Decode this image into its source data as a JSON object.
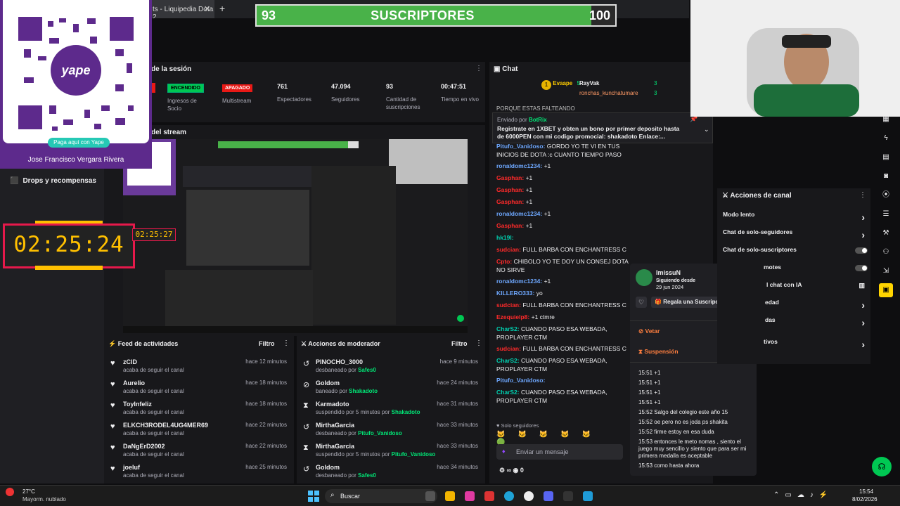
{
  "browser_tab": {
    "title": "ts - Liquipedia Dota 2",
    "close": "✕",
    "new": "+"
  },
  "subgoal": {
    "current": "93",
    "label": "SUSCRIPTORES",
    "target": "100",
    "progress": 0.93
  },
  "qr": {
    "button": "Paga aquí con Yape",
    "name": "Jose Francisco Vergara Rivera",
    "logo": "yape"
  },
  "left_nav": {
    "item": "Drops y recompensas"
  },
  "timer": {
    "value": "02:25:24",
    "mini": "02:25:27"
  },
  "session": {
    "title": "de la sesión",
    "stats": [
      {
        "badge": "ENCENDIDO",
        "label": "Ingresos de Socio"
      },
      {
        "badge": "APAGADO",
        "label": "Multistream"
      },
      {
        "value": "761",
        "label": "Espectadores"
      },
      {
        "value": "47.094",
        "label": "Seguidores"
      },
      {
        "value": "93",
        "label": "Cantidad de suscripciones"
      },
      {
        "value": "00:47:51",
        "label": "Tiempo en vivo"
      }
    ]
  },
  "stream_preview": {
    "title": "del stream"
  },
  "feed": {
    "title": "Feed de actividades",
    "filter": "Filtro",
    "items": [
      {
        "name": "zCID",
        "action": "acaba de seguir el canal",
        "time": "hace 12 minutos"
      },
      {
        "name": "Aurelio",
        "action": "acaba de seguir el canal",
        "time": "hace 18 minutos"
      },
      {
        "name": "ToyInfeliz",
        "action": "acaba de seguir el canal",
        "time": "hace 18 minutos"
      },
      {
        "name": "ELKCH3RODEL4UG4MER69",
        "action": "acaba de seguir el canal",
        "time": "hace 22 minutos"
      },
      {
        "name": "DaNgErD2002",
        "action": "acaba de seguir el canal",
        "time": "hace 22 minutos"
      },
      {
        "name": "joeluf",
        "action": "acaba de seguir el canal",
        "time": "hace 25 minutos"
      }
    ]
  },
  "modactions": {
    "title": "Acciones de moderador",
    "filter": "Filtro",
    "items": [
      {
        "name": "PINOCHO_3000",
        "action": "desbaneado por",
        "by": "Safes0",
        "time": "hace 9 minutos",
        "icon": "undo"
      },
      {
        "name": "Goldom",
        "action": "baneado por",
        "by": "Shakadoto",
        "time": "hace 24 minutos",
        "icon": "ban"
      },
      {
        "name": "Karmadoto",
        "action": "suspendido por 5 minutos por",
        "by": "Shakadoto",
        "time": "hace 31 minutos",
        "icon": "hourglass"
      },
      {
        "name": "MirthaGarcia",
        "action": "desbaneado por",
        "by": "Pitufo_Vanidoso",
        "time": "hace 33 minutos",
        "icon": "undo"
      },
      {
        "name": "MirthaGarcia",
        "action": "suspendido por 5 minutos por",
        "by": "Pitufo_Vanidoso",
        "time": "hace 33 minutos",
        "icon": "hourglass"
      },
      {
        "name": "Goldom",
        "action": "desbaneado por",
        "by": "Safes0",
        "time": "hace 34 minutos",
        "icon": "undo"
      }
    ]
  },
  "chat": {
    "title": "Chat",
    "top_users": [
      "Evaape",
      "RayVak",
      "ronchas_kunchatumare"
    ],
    "top_counts": [
      "5",
      "3",
      "3"
    ],
    "pinned_from": "Enviado por",
    "pinned_user": "BotRix",
    "pinned_text": "Registrate en 1XBET y obten un bono por primer deposito hasta de 6000PEN con mi codigo promocial: shakadoto Enlace:...",
    "top_cut": "PORQUE ESTAS FALTEANDO",
    "lines": [
      {
        "user": "Pitufo_Vanidoso:",
        "text": "GORDO YO TE VI EN TUS INICIOS DE DOTA :c CUANTO TIEMPO PASO",
        "color": "blue"
      },
      {
        "user": "ronaldomc1234:",
        "text": "+1",
        "color": "blue"
      },
      {
        "user": "Gasphan:",
        "text": "+1",
        "color": "red"
      },
      {
        "user": "Gasphan:",
        "text": "+1",
        "color": "red"
      },
      {
        "user": "Gasphan:",
        "text": "+1",
        "color": "red"
      },
      {
        "user": "ronaldomc1234:",
        "text": "+1",
        "color": "blue"
      },
      {
        "user": "Gasphan:",
        "text": "+1",
        "color": "red"
      },
      {
        "user": "hk19l:",
        "text": "",
        "color": "teal"
      },
      {
        "user": "sudcian:",
        "text": "FULL BARBA  CON ENCHANTRESS C",
        "color": "red"
      },
      {
        "user": "Cpto:",
        "text": "CHIBOLO YO TE DOY UN CONSEJ DOTA NO SIRVE",
        "color": "red"
      },
      {
        "user": "ronaldomc1234:",
        "text": "+1",
        "color": "blue"
      },
      {
        "user": "KILLERO333:",
        "text": "yo",
        "color": "blue"
      },
      {
        "user": "sudcian:",
        "text": "FULL BARBA  CON ENCHANTRESS C",
        "color": "red"
      },
      {
        "user": "Ezequielp8:",
        "text": "+1 ctmre",
        "color": "red"
      },
      {
        "user": "CharS2:",
        "text": "CUANDO PASO ESA WEBADA, PROPLAYER CTM",
        "color": "teal"
      },
      {
        "user": "sudcian:",
        "text": "FULL BARBA  CON ENCHANTRESS C",
        "color": "red"
      },
      {
        "user": "CharS2:",
        "text": "CUANDO PASO ESA WEBADA, PROPLAYER CTM",
        "color": "teal"
      },
      {
        "user": "Pitufo_Vanidoso:",
        "text": "",
        "color": "blue"
      },
      {
        "user": "CharS2:",
        "text": "CUANDO PASO ESA WEBADA, PROPLAYER CTM",
        "color": "teal"
      }
    ],
    "followers_only": "Solo seguidores",
    "input_placeholder": "Enviar un mensaje",
    "bits": "0"
  },
  "usercard": {
    "name": "ImissuN",
    "since_label": "Siguiendo desde",
    "since_date": "29 jun 2024",
    "gift": "Regala una Suscripción",
    "ban": "Vetar",
    "timeout": "Suspensión",
    "messages": [
      {
        "t": "15:51",
        "m": "+1"
      },
      {
        "t": "15:51",
        "m": "+1"
      },
      {
        "t": "15:51",
        "m": "+1"
      },
      {
        "t": "15:51",
        "m": "+1"
      },
      {
        "t": "15:52",
        "m": "Salgo del colegio este año 15"
      },
      {
        "t": "15:52",
        "m": "oe pero no es joda ps shakita"
      },
      {
        "t": "15:52",
        "m": "firme estoy en esa duda"
      },
      {
        "t": "15:53",
        "m": "entonces le meto nomas , siento el juego muy sencillo y siento que para ser mi primera medalla es aceptable"
      },
      {
        "t": "15:53",
        "m": "como hasta ahora"
      }
    ]
  },
  "channel_actions": {
    "title": "Acciones de canal",
    "items": [
      {
        "label": "Modo lento",
        "type": "arrow"
      },
      {
        "label": "Chat de solo-seguidores",
        "type": "arrow"
      },
      {
        "label": "Chat de solo-suscriptores",
        "type": "toggle"
      },
      {
        "label": "motes",
        "type": "toggle"
      },
      {
        "label": "l chat con IA",
        "type": "bars"
      },
      {
        "label": "edad",
        "type": "arrow"
      },
      {
        "label": "das",
        "type": "arrow"
      },
      {
        "label": "tivos",
        "type": "arrow"
      }
    ]
  },
  "taskbar": {
    "weather_temp": "27°C",
    "weather_desc": "Mayorm. nublado",
    "search": "Buscar",
    "time": "15:54",
    "date": "8/02/2026"
  },
  "colors": {
    "accent": "#9147ff",
    "green": "#00c853",
    "red": "#e91916",
    "yape": "#5d2a8c"
  }
}
